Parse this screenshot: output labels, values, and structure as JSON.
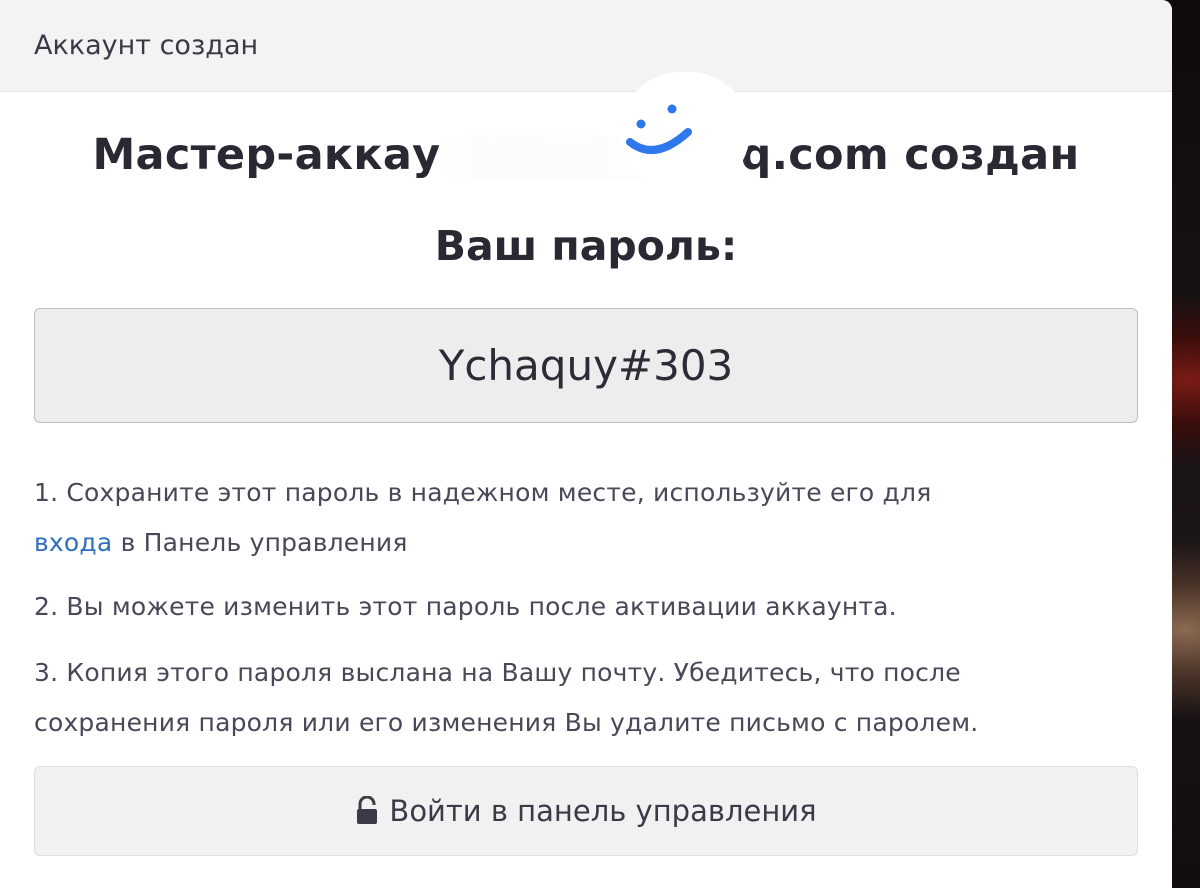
{
  "modal": {
    "header_title": "Аккаунт создан",
    "master_prefix": "Мастер-аккау",
    "master_suffix": "q.com создан",
    "password_label": "Ваш пароль:",
    "password_value": "Ychaquy#303"
  },
  "notes": {
    "n1_text_a": "1. Сохраните этот пароль в надежном месте, используйте его для",
    "n1_link": "входа",
    "n1_text_b": " в Панель управления",
    "n2": "2. Вы можете изменить этот пароль после активации аккаунта.",
    "n3_line1": "3. Копия этого пароля выслана на Вашу почту. Убедитесь, что после",
    "n3_line2": "сохранения пароля или его изменения Вы удалите письмо с паролем."
  },
  "actions": {
    "login_label": "Войти в панель управления"
  },
  "icons": {
    "smiley": "smiley-icon",
    "lock": "unlock-icon",
    "cursor": "text-cursor-icon"
  },
  "colors": {
    "link": "#2f6fbf",
    "smiley": "#2f77ec",
    "text": "#2b2733"
  }
}
